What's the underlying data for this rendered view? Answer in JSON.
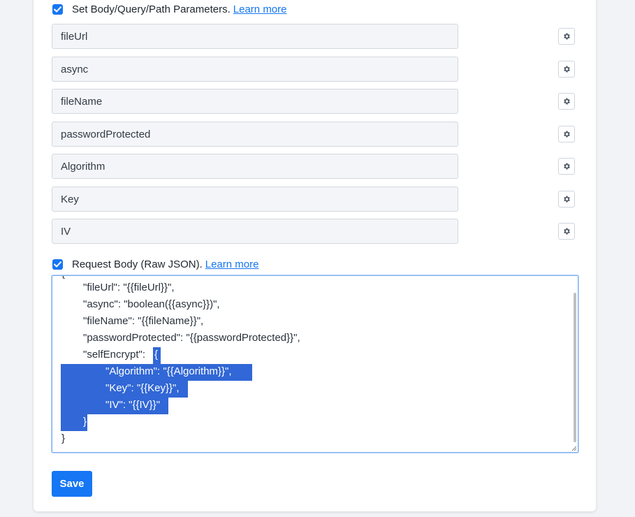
{
  "params_section": {
    "checkbox_label": "Set Body/Query/Path Parameters.",
    "learn_more": "Learn more",
    "checked": true,
    "fields": [
      {
        "value": "fileUrl"
      },
      {
        "value": "async"
      },
      {
        "value": "fileName"
      },
      {
        "value": "passwordProtected"
      },
      {
        "value": "Algorithm"
      },
      {
        "value": "Key"
      },
      {
        "value": "IV"
      }
    ]
  },
  "body_section": {
    "checkbox_label": "Request Body (Raw JSON).",
    "learn_more": "Learn more",
    "checked": true,
    "json_lines": {
      "l0": "{",
      "l1": "\"fileUrl\": \"{{fileUrl}}\",",
      "l2": "\"async\": \"boolean({{async}})\",",
      "l3": "\"fileName\": \"{{fileName}}\",",
      "l4": "\"passwordProtected\": \"{{passwordProtected}}\",",
      "l5a": "\"selfEncrypt\":",
      "l5b": "{",
      "l6": "\"Algorithm\": \"{{Algorithm}}\",",
      "l7": "\"Key\": \"{{Key}}\",",
      "l8": "\"IV\": \"{{IV}}\"",
      "l9": "}",
      "l10": "}"
    }
  },
  "actions": {
    "save_label": "Save"
  },
  "colors": {
    "accent": "#1676f3",
    "selection": "#3167d6"
  }
}
